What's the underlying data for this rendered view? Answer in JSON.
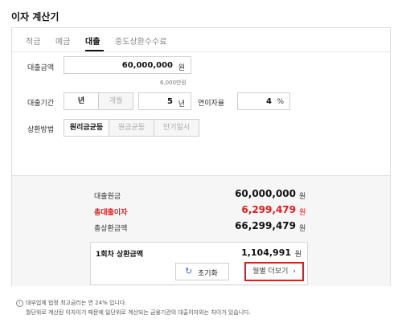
{
  "title": "이자 계산기",
  "tabs": [
    {
      "label": "적금"
    },
    {
      "label": "예금"
    },
    {
      "label": "대출"
    },
    {
      "label": "중도상환수수료"
    }
  ],
  "loan_amount": {
    "label": "대출금액",
    "value": "60,000,000",
    "unit": "원",
    "hint": "6,000만원"
  },
  "loan_period": {
    "label": "대출기간",
    "opt_year": "년",
    "opt_month": "개월",
    "value": "5",
    "unit": "년"
  },
  "interest": {
    "label": "연이자율",
    "value": "4",
    "unit": "%"
  },
  "repay": {
    "label": "상환방법",
    "options": [
      "원리금균등",
      "원금균등",
      "만기일시"
    ]
  },
  "results": {
    "principal_label": "대출원금",
    "principal_value": "60,000,000",
    "principal_unit": "원",
    "interest_label": "총대출이자",
    "interest_value": "6,299,479",
    "interest_unit": "원",
    "total_label": "총상환금액",
    "total_value": "66,299,479",
    "total_unit": "원",
    "first_label": "1회차 상환금액",
    "first_value": "1,104,991",
    "first_unit": "원",
    "more_label": "월별 더보기"
  },
  "reset_label": "초기화",
  "notes": [
    "대부업체 법정 최고금리는 연 24% 입니다.",
    "월단위로 계산된 이자이기 때문에 일단위로 계산되는 금융기관의 대출이자와는 차이가 있습니다."
  ],
  "colors": {
    "accent_red": "#e31b1b"
  }
}
